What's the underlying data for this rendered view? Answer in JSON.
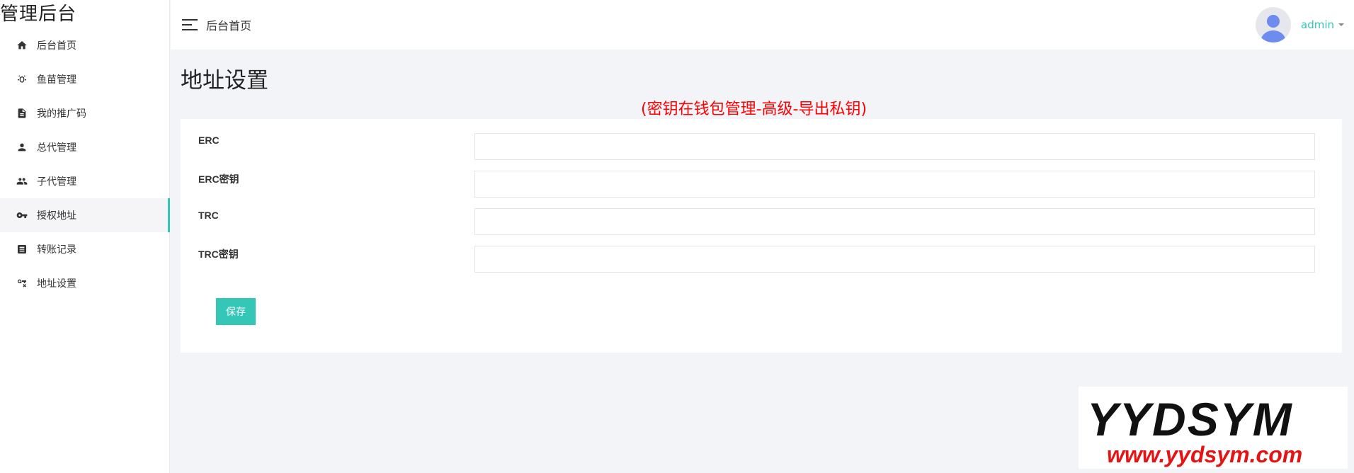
{
  "brand": "管理后台",
  "sidebar": {
    "items": [
      {
        "label": "后台首页",
        "icon": "home-icon"
      },
      {
        "label": "鱼苗管理",
        "icon": "fish-icon"
      },
      {
        "label": "我的推广码",
        "icon": "document-icon"
      },
      {
        "label": "总代管理",
        "icon": "person-icon"
      },
      {
        "label": "子代管理",
        "icon": "people-icon"
      },
      {
        "label": "授权地址",
        "icon": "key-icon",
        "active": true
      },
      {
        "label": "转账记录",
        "icon": "list-icon"
      },
      {
        "label": "地址设置",
        "icon": "key-settings-icon"
      }
    ]
  },
  "header": {
    "breadcrumb": "后台首页",
    "username": "admin"
  },
  "page": {
    "title": "地址设置",
    "notice": "(密钥在钱包管理-高级-导出私钥)"
  },
  "form": {
    "fields": [
      {
        "label": "ERC",
        "value": ""
      },
      {
        "label": "ERC密钥",
        "value": ""
      },
      {
        "label": "TRC",
        "value": ""
      },
      {
        "label": "TRC密钥",
        "value": ""
      }
    ],
    "save_label": "保存"
  },
  "watermark": {
    "line1": "YYDSYM",
    "line2": "www.yydsym.com"
  },
  "colors": {
    "accent": "#34c6b7",
    "notice": "#ff0000",
    "background": "#f3f4f8"
  }
}
